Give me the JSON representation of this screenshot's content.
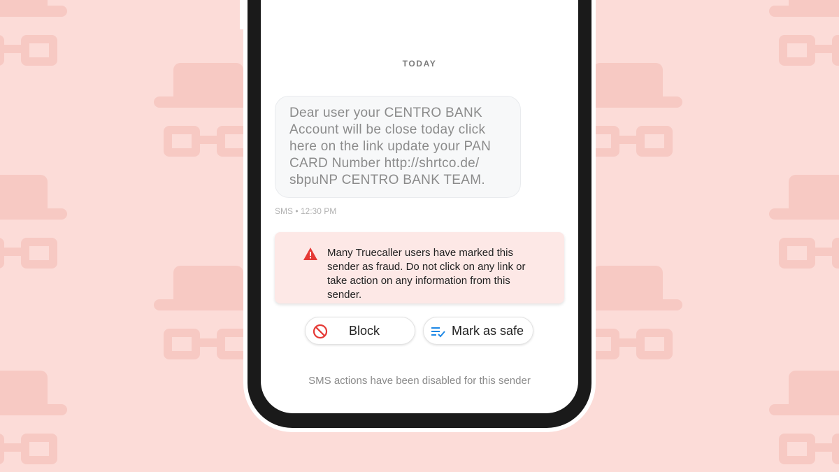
{
  "conversation": {
    "date_separator": "TODAY",
    "message": {
      "text": "Dear user your CENTRO BANK Account will be close today click here on the link update your PAN CARD Number http://shrtco.de/ sbpuNP CENTRO BANK TEAM.",
      "meta": "SMS • 12:30 PM"
    }
  },
  "fraud_warning": {
    "icon": "warning-triangle-icon",
    "text": "Many Truecaller users have marked this sender as fraud. Do not click on any link or take action on any information from this sender."
  },
  "actions": {
    "block_label": "Block",
    "block_icon": "block-icon",
    "mark_safe_label": "Mark as safe",
    "mark_safe_icon": "list-check-icon"
  },
  "footer_note": "SMS actions have been disabled for this sender",
  "colors": {
    "background": "#fcdcd8",
    "warning_bg": "#fde8e6",
    "danger": "#e53935",
    "accent_blue": "#1e88e5",
    "phone_frame": "#1a1a1a"
  }
}
